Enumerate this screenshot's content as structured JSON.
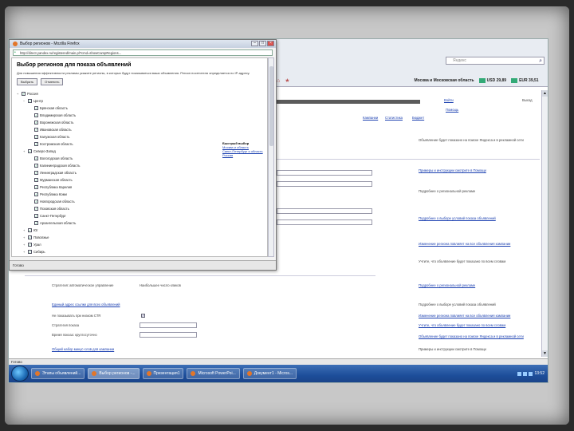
{
  "popup": {
    "title": "Выбор регионов - Mozilla Firefox",
    "url": "http://direct.yandex.ru/registered/main.pl?cmd=showCampRegions...",
    "heading": "Выбор регионов для показа объявлений",
    "description": "Для повышения эффективности рекламы укажите регионы, в которых будут показываться ваши объявления. Регион посетителя определяется по IP-адресу.",
    "buttons": [
      "Выбрать",
      "Отменить"
    ],
    "tree": [
      {
        "level": 0,
        "label": "Россия",
        "toggle": "+"
      },
      {
        "level": 1,
        "label": "Центр",
        "toggle": "−"
      },
      {
        "level": 2,
        "label": "Брянская область"
      },
      {
        "level": 2,
        "label": "Владимирская область"
      },
      {
        "level": 2,
        "label": "Воронежская область"
      },
      {
        "level": 2,
        "label": "Ивановская область"
      },
      {
        "level": 2,
        "label": "Калужская область"
      },
      {
        "level": 2,
        "label": "Костромская область"
      },
      {
        "level": 1,
        "label": "Северо-Запад",
        "toggle": "+"
      },
      {
        "level": 2,
        "label": "Вологодская область"
      },
      {
        "level": 2,
        "label": "Калининградская область"
      },
      {
        "level": 2,
        "label": "Ленинградская область"
      },
      {
        "level": 2,
        "label": "Мурманская область"
      },
      {
        "level": 2,
        "label": "Республика Карелия"
      },
      {
        "level": 2,
        "label": "Республика Коми"
      },
      {
        "level": 2,
        "label": "Новгородская область"
      },
      {
        "level": 2,
        "label": "Псковская область"
      },
      {
        "level": 2,
        "label": "Санкт-Петербург"
      },
      {
        "level": 2,
        "label": "Архангельская область"
      },
      {
        "level": 1,
        "label": "Юг",
        "toggle": "+"
      },
      {
        "level": 1,
        "label": "Поволжье",
        "toggle": "+"
      },
      {
        "level": 1,
        "label": "Урал",
        "toggle": "+"
      },
      {
        "level": 1,
        "label": "Сибирь",
        "toggle": "+"
      }
    ],
    "side_links": {
      "title": "Быстрый выбор",
      "items": [
        "Москва и область",
        "Санкт-Петербург и область",
        "Россия"
      ]
    },
    "status": "Готово"
  },
  "browser": {
    "search_placeholder": "Яндекс",
    "region": "Москва и Московская область",
    "rate_usd": "USD 29,89",
    "rate_eur": "EUR 39,51",
    "status": "Готово"
  },
  "page": {
    "top_links": [
      "Войти",
      "Помощь",
      "Выход"
    ],
    "nav_links": [
      "Кампании",
      "Статистика",
      "Бюджет"
    ],
    "notes": [
      "Объявление будет показано на поиске Яндекса и в рекламной сети",
      "Примеры и инструкции смотрите в Помощи",
      "Подробнее о региональной рекламе",
      "Подробнее о выборе условий показа объявлений",
      "Изменение региона повлияет на все объявления кампании",
      "Учтите, что объявление будет показано по всем словам"
    ],
    "left_labels": [
      "Стратегия: автоматическое управление",
      "Единый адрес ссылки для всех объявлений",
      "Не показывать при низком CTR",
      "Стратегия показа",
      "Время показа: круглосуточно",
      "Общий набор минус-слов для кампании"
    ],
    "strategy_value": "Наибольшее число кликов"
  },
  "taskbar": {
    "items": [
      "Этапы объявлений...",
      "Выбор регионов -...",
      "Презентация1",
      "Microsoft PowerPoi...",
      "Документ1 - Micros..."
    ],
    "clock": "13:52"
  },
  "colors": {
    "link": "#1a3fb0",
    "taskbar": "#1d4e9a"
  }
}
